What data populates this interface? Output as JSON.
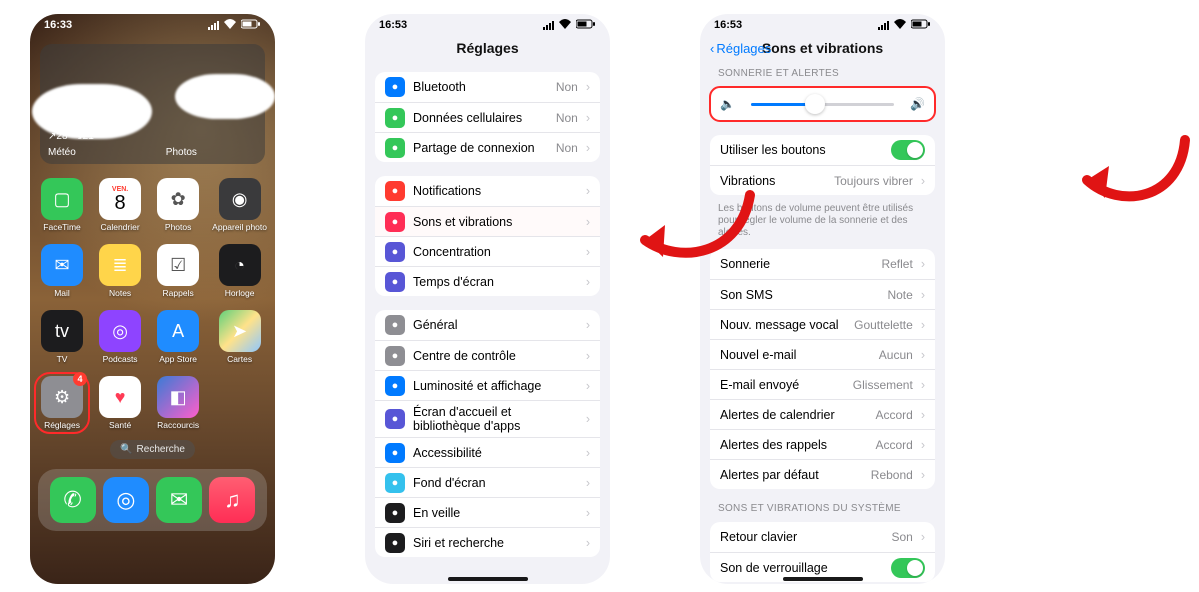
{
  "phone1": {
    "time": "16:33",
    "weather": {
      "condition": "Nuageux",
      "temps": "↗28° ↘21°",
      "widget_label": "Météo",
      "side_label": "Photos"
    },
    "search": "Recherche",
    "apps": [
      {
        "label": "FaceTime",
        "emoji": "▢",
        "bg": "#34c759"
      },
      {
        "label": "Calendrier",
        "day": "VEN.",
        "num": "8",
        "bg": "#ffffff"
      },
      {
        "label": "Photos",
        "emoji": "✿",
        "bg": "#ffffff"
      },
      {
        "label": "Appareil photo",
        "emoji": "◉",
        "bg": "#3a3a3c"
      },
      {
        "label": "Mail",
        "emoji": "✉︎",
        "bg": "#1f8cff"
      },
      {
        "label": "Notes",
        "emoji": "≣",
        "bg": "#ffd54a"
      },
      {
        "label": "Rappels",
        "emoji": "☑︎",
        "bg": "#ffffff"
      },
      {
        "label": "Horloge",
        "emoji": "◔",
        "bg": "#1c1c1e"
      },
      {
        "label": "TV",
        "emoji": "tv",
        "bg": "#1c1c1e"
      },
      {
        "label": "Podcasts",
        "emoji": "◎",
        "bg": "#8e44ff"
      },
      {
        "label": "App Store",
        "emoji": "A",
        "bg": "#1f8cff"
      },
      {
        "label": "Cartes",
        "emoji": "➤",
        "bg": "linear-gradient(135deg,#5fd07a,#ffe28a,#8ec7ff)"
      },
      {
        "label": "Réglages",
        "emoji": "⚙︎",
        "bg": "#8e8e93",
        "hl": true,
        "badge": "4"
      },
      {
        "label": "Santé",
        "emoji": "♥︎",
        "bg": "#ffffff",
        "fg": "#ff3b55"
      },
      {
        "label": "Raccourcis",
        "emoji": "◧",
        "bg": "linear-gradient(135deg,#3a7bd5,#ff5ecb)"
      }
    ],
    "dock": [
      {
        "name": "phone-icon",
        "emoji": "✆",
        "bg": "#34c759"
      },
      {
        "name": "safari-icon",
        "emoji": "◎",
        "bg": "#1f8cff"
      },
      {
        "name": "messages-icon",
        "emoji": "✉︎",
        "bg": "#34c759"
      },
      {
        "name": "music-icon",
        "emoji": "♫",
        "bg": "linear-gradient(180deg,#ff5e72,#ff2d55)"
      }
    ]
  },
  "phone2": {
    "time": "16:53",
    "title": "Réglages",
    "group1": [
      {
        "icon": "bluetooth-icon",
        "bg": "#007aff",
        "label": "Bluetooth",
        "value": "Non"
      },
      {
        "icon": "cellular-icon",
        "bg": "#34c759",
        "label": "Données cellulaires",
        "value": "Non"
      },
      {
        "icon": "hotspot-icon",
        "bg": "#34c759",
        "label": "Partage de connexion",
        "value": "Non"
      }
    ],
    "group2": [
      {
        "icon": "bell-icon",
        "bg": "#ff3b30",
        "label": "Notifications"
      },
      {
        "icon": "speaker-icon",
        "bg": "#ff2d55",
        "label": "Sons et vibrations",
        "hl": true
      },
      {
        "icon": "moon-icon",
        "bg": "#5856d6",
        "label": "Concentration"
      },
      {
        "icon": "hourglass-icon",
        "bg": "#5856d6",
        "label": "Temps d'écran"
      }
    ],
    "group3": [
      {
        "icon": "gear-icon",
        "bg": "#8e8e93",
        "label": "Général"
      },
      {
        "icon": "sliders-icon",
        "bg": "#8e8e93",
        "label": "Centre de contrôle"
      },
      {
        "icon": "sun-icon",
        "bg": "#007aff",
        "label": "Luminosité et affichage"
      },
      {
        "icon": "apps-icon",
        "bg": "#5856d6",
        "label": "Écran d'accueil et bibliothèque d'apps"
      },
      {
        "icon": "person-icon",
        "bg": "#007aff",
        "label": "Accessibilité"
      },
      {
        "icon": "wallpaper-icon",
        "bg": "#34c1ed",
        "label": "Fond d'écran"
      },
      {
        "icon": "standby-icon",
        "bg": "#1c1c1e",
        "label": "En veille"
      },
      {
        "icon": "siri-icon",
        "bg": "#1c1c1e",
        "label": "Siri et recherche"
      }
    ]
  },
  "phone3": {
    "time": "16:53",
    "back": "Réglages",
    "title": "Sons et vibrations",
    "header1": "SONNERIE ET ALERTES",
    "buttons_label": "Utiliser les boutons",
    "vibe_label": "Vibrations",
    "vibe_value": "Toujours vibrer",
    "footer1": "Les boutons de volume peuvent être utilisés pour régler le volume de la sonnerie et des alertes.",
    "group2": [
      {
        "label": "Sonnerie",
        "value": "Reflet"
      },
      {
        "label": "Son SMS",
        "value": "Note"
      },
      {
        "label": "Nouv. message vocal",
        "value": "Gouttelette"
      },
      {
        "label": "Nouvel e-mail",
        "value": "Aucun"
      },
      {
        "label": "E-mail envoyé",
        "value": "Glissement"
      },
      {
        "label": "Alertes de calendrier",
        "value": "Accord"
      },
      {
        "label": "Alertes des rappels",
        "value": "Accord"
      },
      {
        "label": "Alertes par défaut",
        "value": "Rebond"
      }
    ],
    "header2": "SONS ET VIBRATIONS DU SYSTÈME",
    "group3": [
      {
        "label": "Retour clavier",
        "value": "Son"
      },
      {
        "label": "Son de verrouillage",
        "toggle": true
      }
    ]
  }
}
